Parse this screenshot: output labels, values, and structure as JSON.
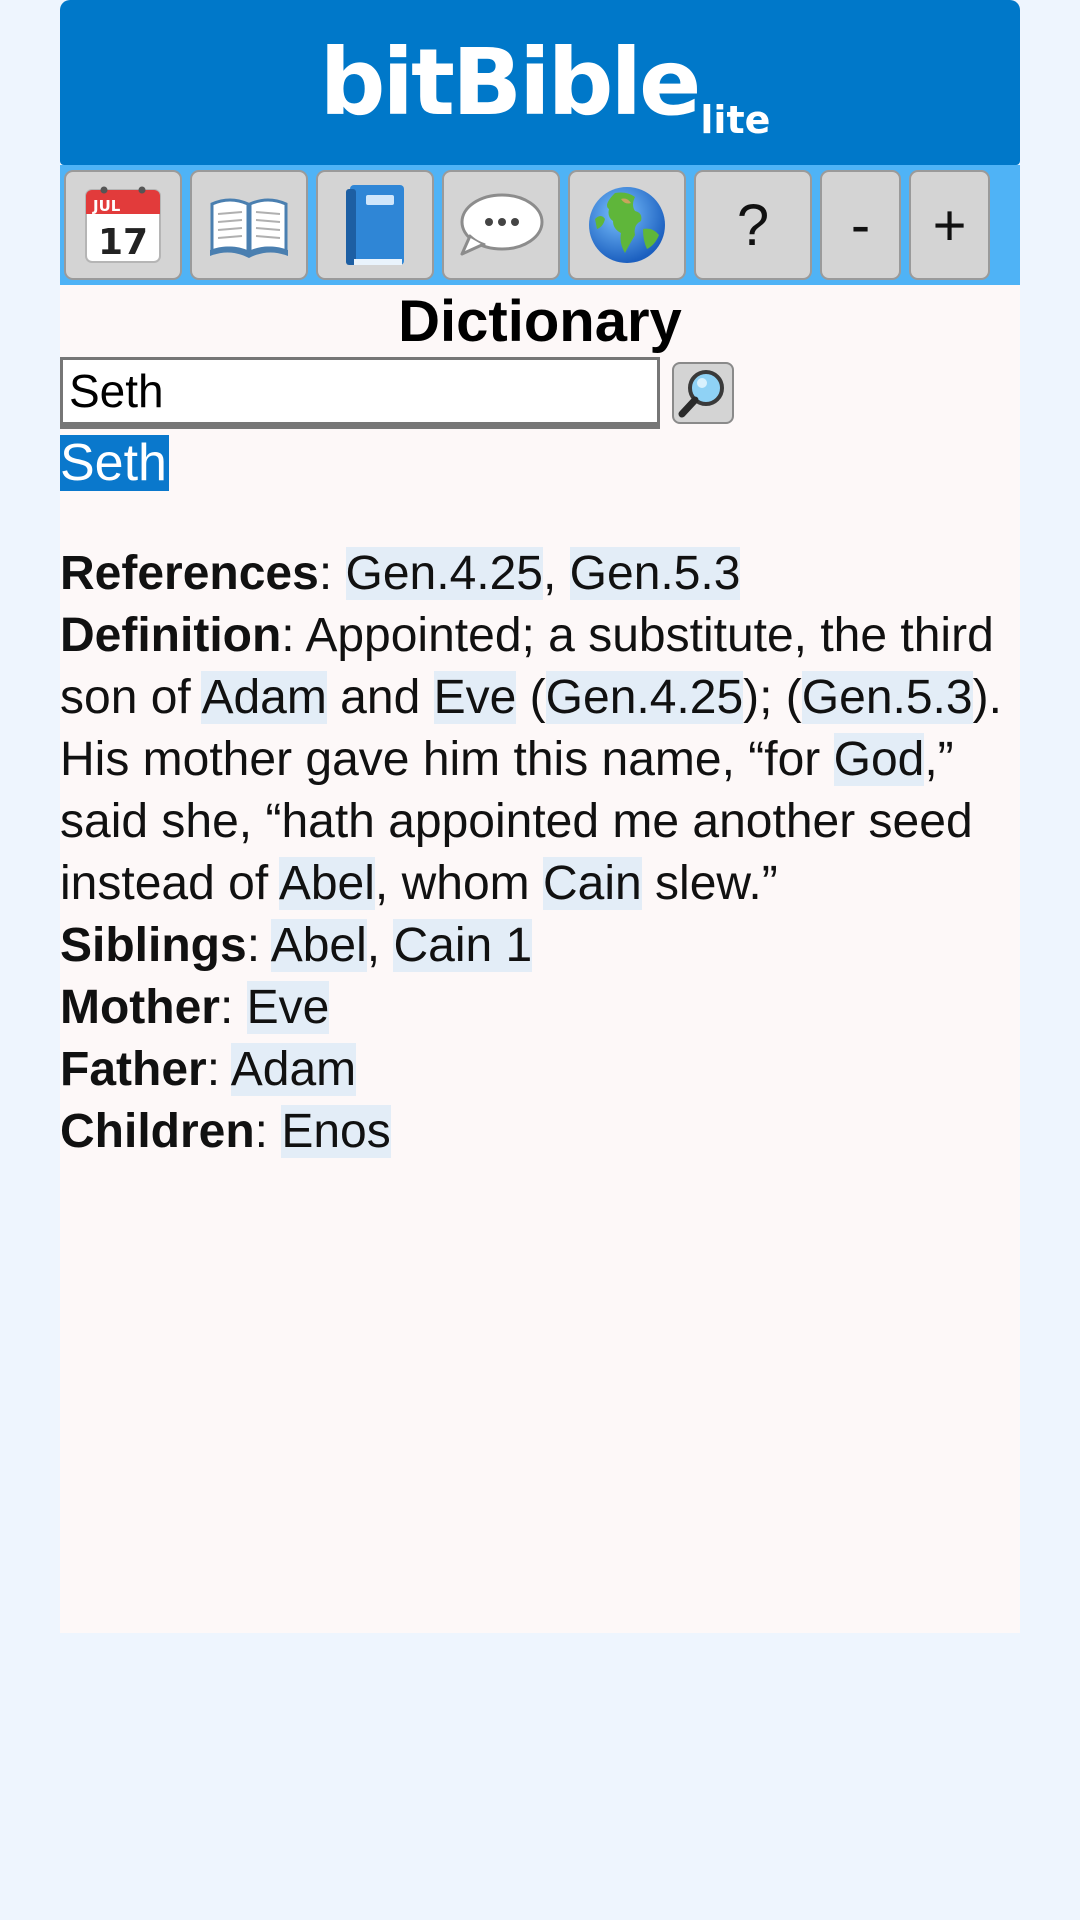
{
  "header": {
    "logo_main": "bitBible",
    "logo_sub": "lite"
  },
  "toolbar": {
    "calendar": {
      "month": "JUL",
      "day": "17",
      "icon": "calendar-icon"
    },
    "open_book_icon": "open-book-icon",
    "blue_book_icon": "blue-book-icon",
    "speech_icon": "speech-bubble-icon",
    "globe_icon": "globe-icon",
    "help_label": "?",
    "zoom_out_label": "-",
    "zoom_in_label": "+"
  },
  "page_title": "Dictionary",
  "search": {
    "value": "Seth",
    "icon": "magnifier-icon"
  },
  "selected_entry": "Seth",
  "entry": {
    "references_label": "References",
    "references": [
      "Gen.4.25",
      "Gen.5.3"
    ],
    "definition_label": "Definition",
    "definition_parts": {
      "p1": ": Appointed; a substitute, the third son of ",
      "adam": "Adam",
      "p2": " and ",
      "eve": "Eve",
      "p3": " (",
      "ref1": "Gen.4.25",
      "p4": "); (",
      "ref2": "Gen.5.3",
      "p5": "). His mother gave him this name, “for ",
      "god": "God",
      "p6": ",” said she, “hath appointed me another seed instead of ",
      "abel": "Abel",
      "p7": ", whom ",
      "cain": "Cain",
      "p8": " slew.”"
    },
    "siblings_label": "Siblings",
    "siblings": [
      "Abel",
      "Cain 1"
    ],
    "mother_label": "Mother",
    "mother": "Eve",
    "father_label": "Father",
    "father": "Adam",
    "children_label": "Children",
    "children": "Enos"
  },
  "colors": {
    "header_bg": "#0078c9",
    "toolbar_bg": "#4fb3f6",
    "selected_bg": "#0a78cc",
    "link_bg": "#e3edf7",
    "page_bg": "#eef5fe",
    "content_bg": "#fdf8f8"
  }
}
